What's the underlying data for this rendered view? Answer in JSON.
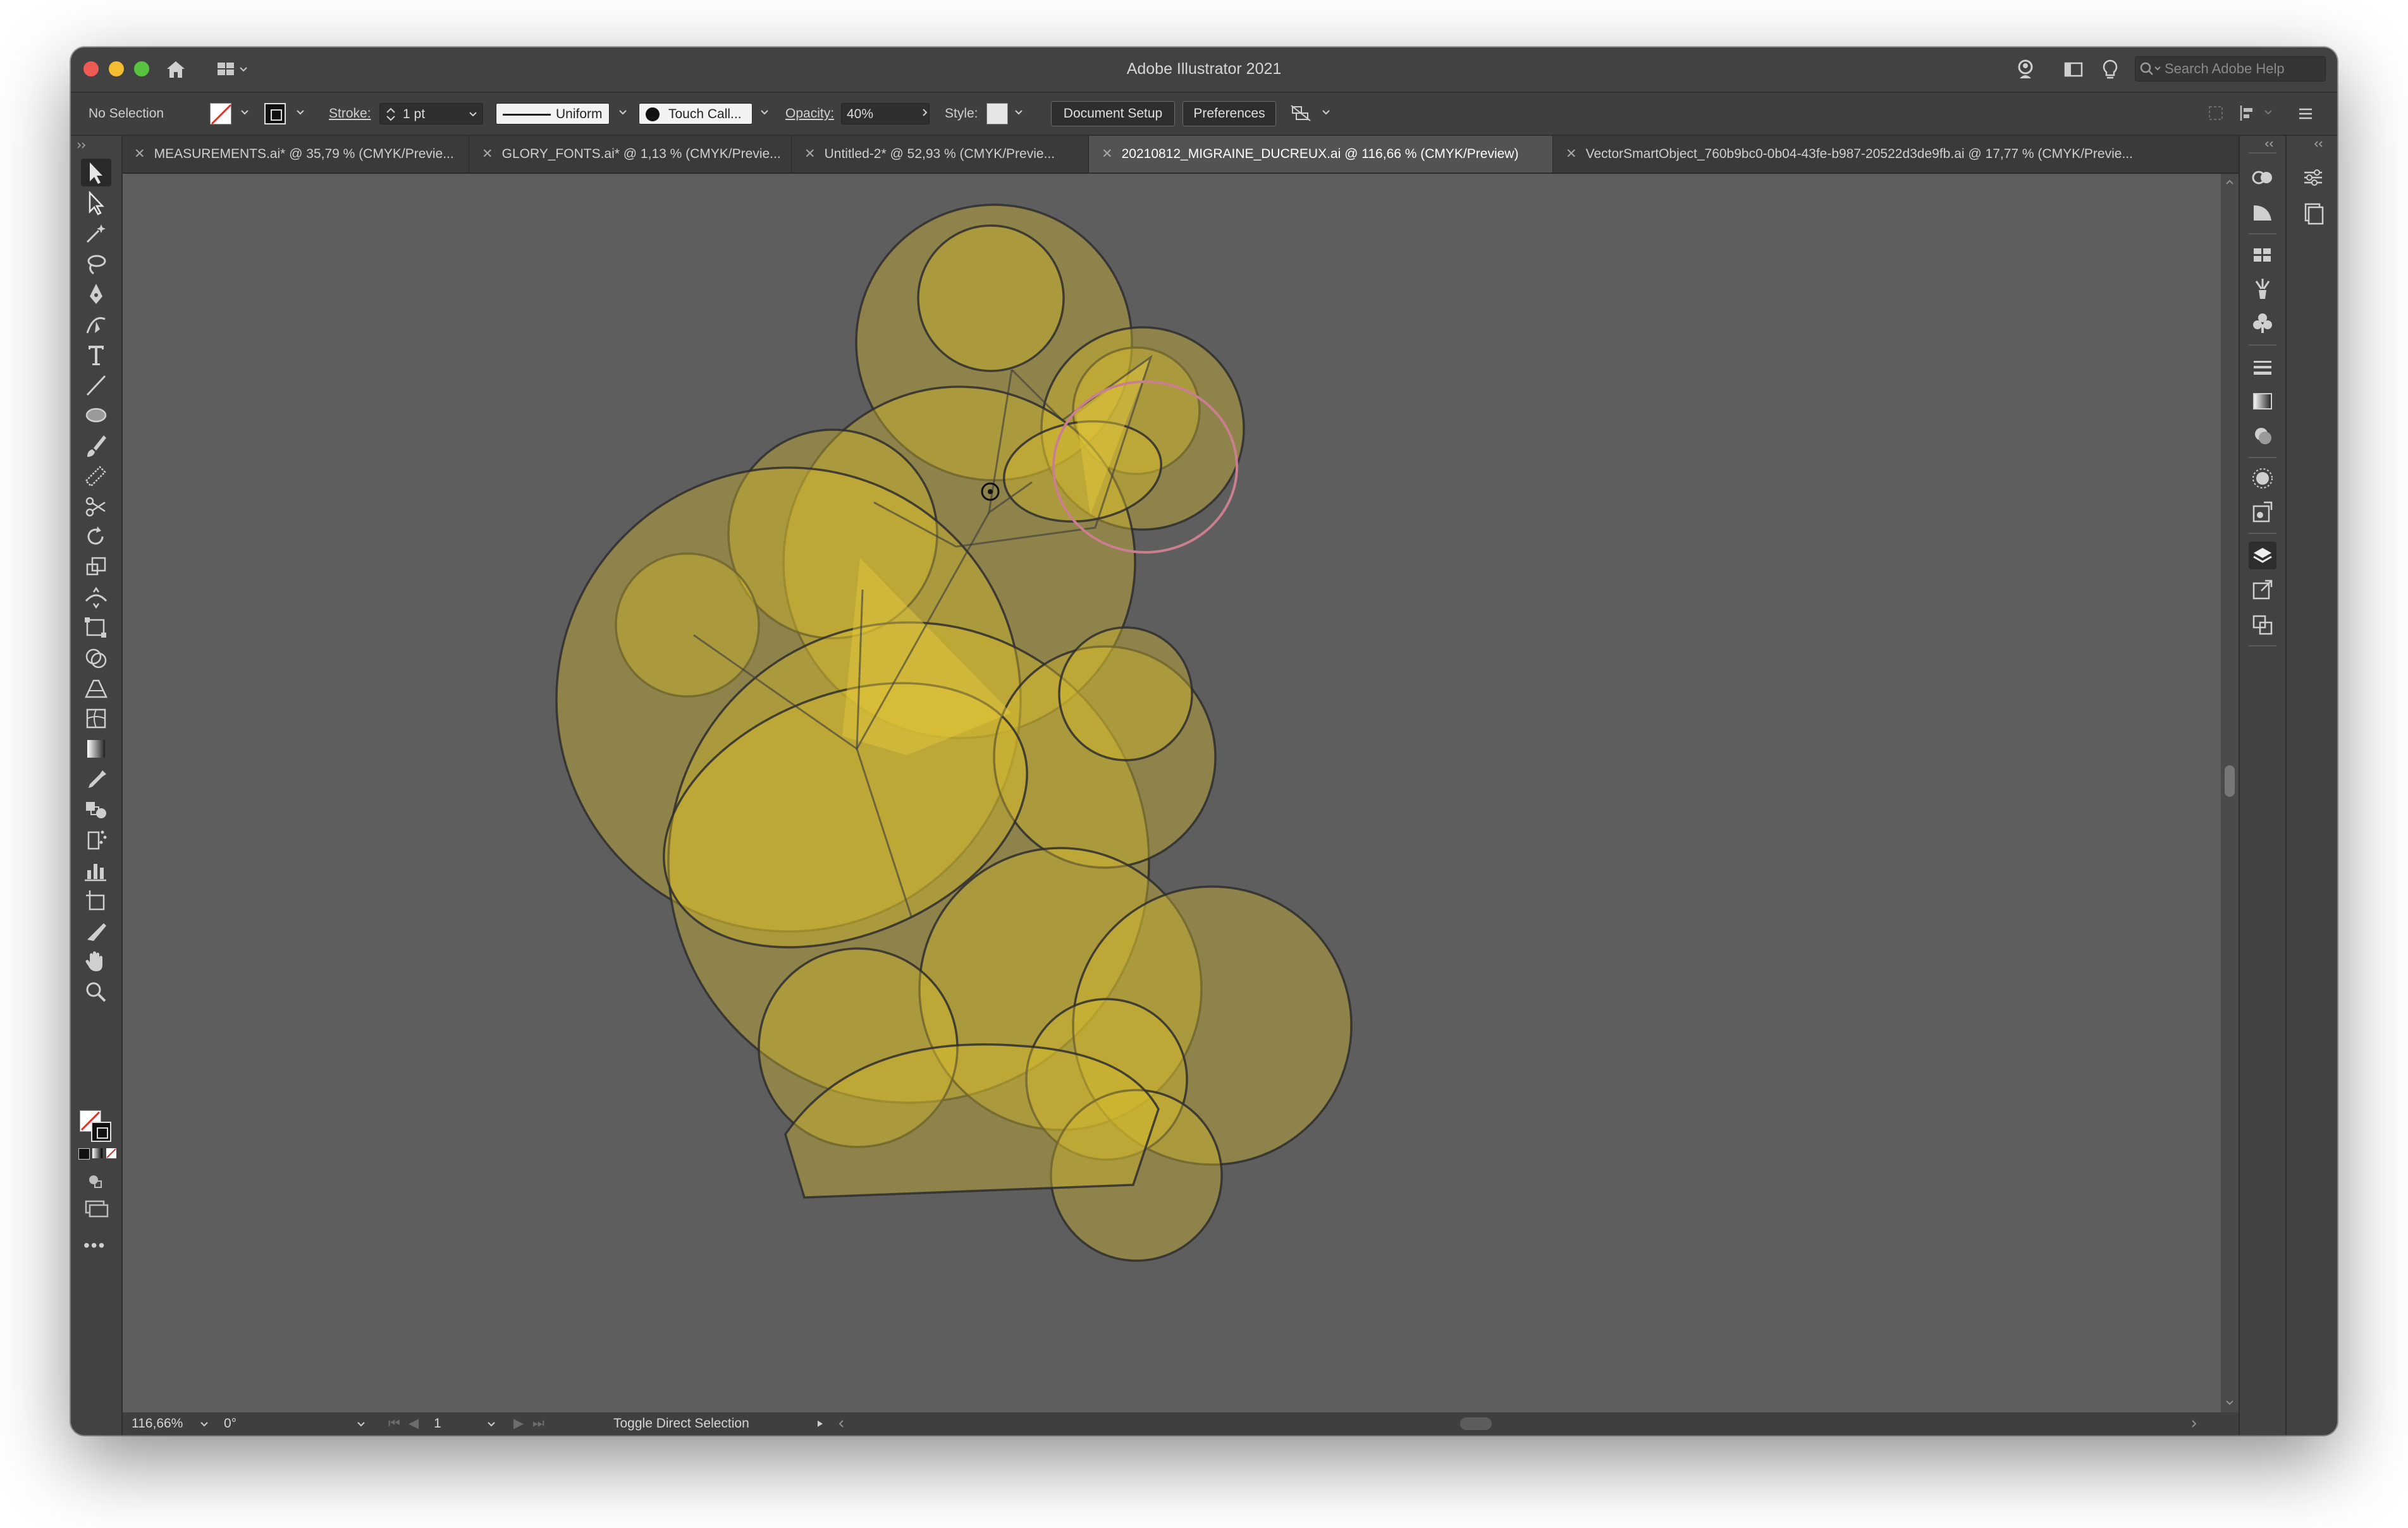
{
  "window": {
    "title": "Adobe Illustrator 2021",
    "search_placeholder": "Search Adobe Help"
  },
  "control_bar": {
    "selection_status": "No Selection",
    "stroke_label": "Stroke:",
    "stroke_weight": "1 pt",
    "stroke_profile": "Uniform",
    "brush": "Touch Call...",
    "opacity_label": "Opacity:",
    "opacity_value": "40%",
    "style_label": "Style:",
    "document_setup": "Document Setup",
    "preferences": "Preferences"
  },
  "tabs": [
    {
      "label": "MEASUREMENTS.ai* @ 35,79 % (CMYK/Previe...",
      "active": false
    },
    {
      "label": "GLORY_FONTS.ai* @ 1,13 % (CMYK/Previe...",
      "active": false
    },
    {
      "label": "Untitled-2* @ 52,93 % (CMYK/Previe...",
      "active": false
    },
    {
      "label": "20210812_MIGRAINE_DUCREUX.ai @ 116,66 % (CMYK/Preview)",
      "active": true
    },
    {
      "label": "VectorSmartObject_760b9bc0-0b04-43fe-b987-20522d3de9fb.ai @ 17,77 % (CMYK/Previe...",
      "active": false
    }
  ],
  "tools": [
    "selection-tool-icon",
    "direct-selection-tool-icon",
    "magic-wand-tool-icon",
    "lasso-tool-icon",
    "pen-tool-icon",
    "curvature-tool-icon",
    "type-tool-icon",
    "line-segment-tool-icon",
    "ellipse-tool-icon",
    "paintbrush-tool-icon",
    "shaper-tool-icon",
    "scissors-tool-icon",
    "rotate-tool-icon",
    "scale-tool-icon",
    "width-tool-icon",
    "free-transform-tool-icon",
    "shape-builder-tool-icon",
    "perspective-grid-tool-icon",
    "mesh-tool-icon",
    "gradient-tool-icon",
    "eyedropper-tool-icon",
    "blend-tool-icon",
    "symbol-sprayer-tool-icon",
    "column-graph-tool-icon",
    "artboard-tool-icon",
    "slice-tool-icon",
    "hand-tool-icon",
    "zoom-tool-icon"
  ],
  "status_bar": {
    "zoom": "116,66%",
    "rotation": "0°",
    "artboard": "1",
    "tool_hint": "Toggle Direct Selection"
  },
  "colors": {
    "shape_fill": "#d6bb2c",
    "canvas": "#5e5e5e",
    "selection_ring": "#c97f8e"
  }
}
